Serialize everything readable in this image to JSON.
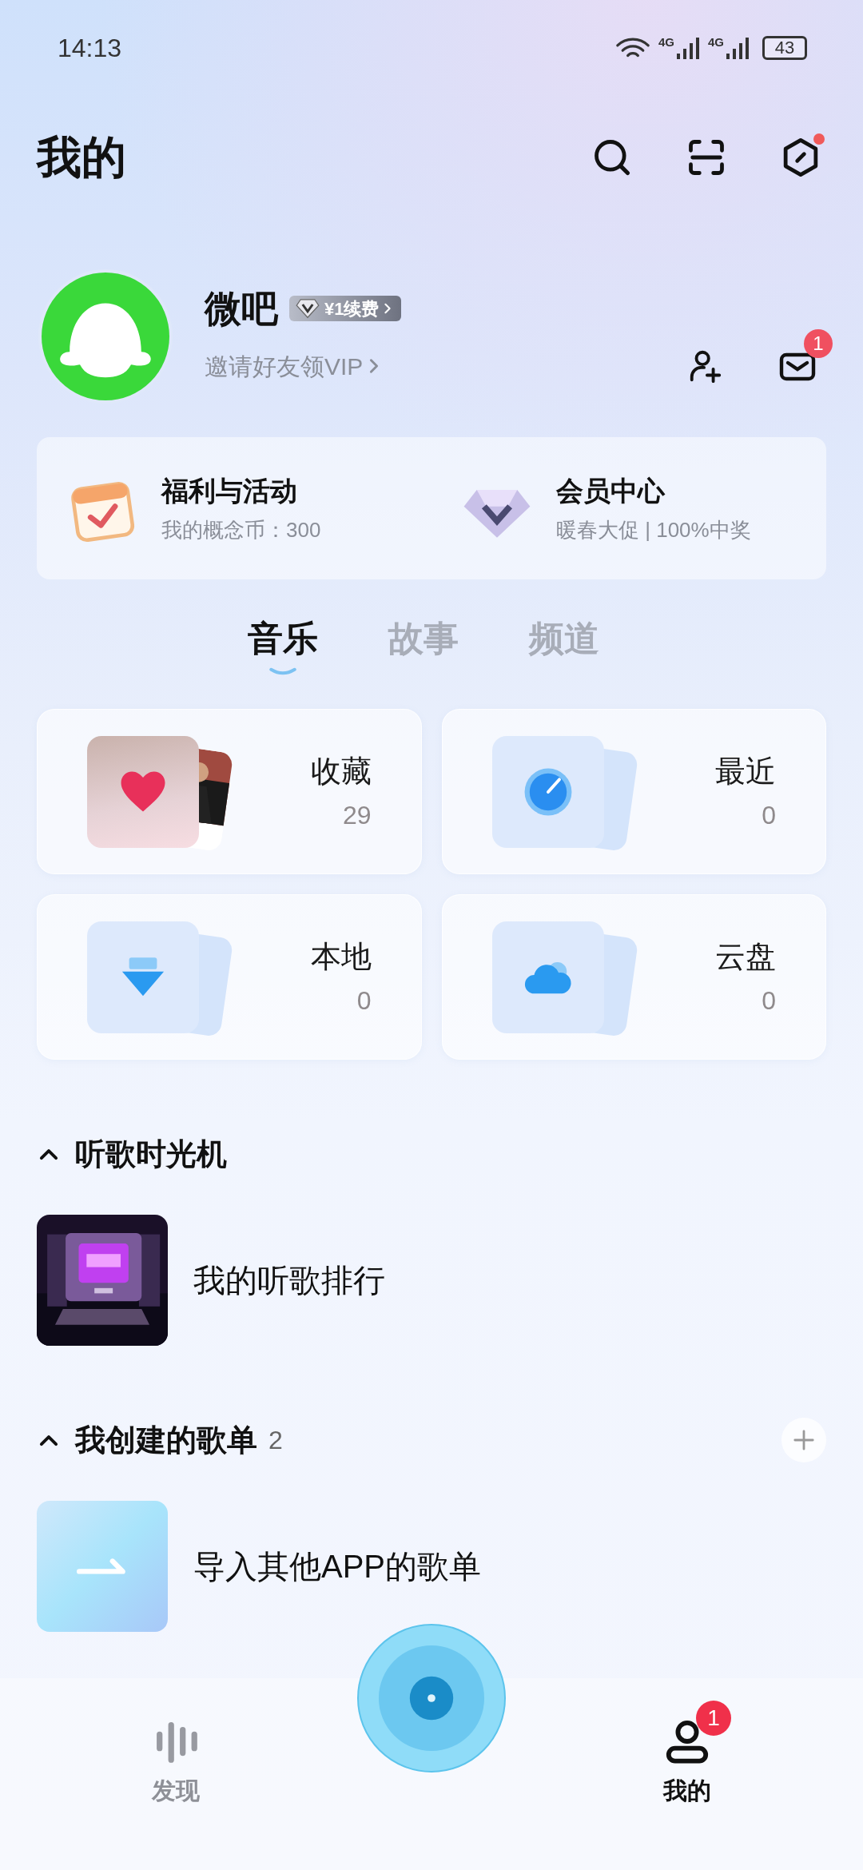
{
  "status_bar": {
    "time": "14:13",
    "networks": [
      "4G",
      "4G"
    ],
    "battery": "43"
  },
  "header": {
    "title": "我的",
    "settings_dot": true
  },
  "profile": {
    "name": "微吧",
    "vip_badge": "¥1续费",
    "invite_link": "邀请好友领VIP",
    "messages_badge": "1"
  },
  "promos": [
    {
      "kind": "calendar",
      "title": "福利与活动",
      "subtitle": "我的概念币：300"
    },
    {
      "kind": "diamond",
      "title": "会员中心",
      "subtitle": "暖春大促 | 100%中奖"
    }
  ],
  "tabs": [
    {
      "label": "音乐",
      "selected": true
    },
    {
      "label": "故事",
      "selected": false
    },
    {
      "label": "频道",
      "selected": false
    }
  ],
  "library": [
    {
      "kind": "favorites",
      "label": "收藏",
      "count": "29"
    },
    {
      "kind": "recent",
      "label": "最近",
      "count": "0"
    },
    {
      "kind": "local",
      "label": "本地",
      "count": "0"
    },
    {
      "kind": "cloud",
      "label": "云盘",
      "count": "0"
    }
  ],
  "sections": [
    {
      "title": "听歌时光机",
      "expanded": true,
      "items": [
        {
          "kind": "picture",
          "title": "我的听歌排行"
        }
      ]
    },
    {
      "title": "我创建的歌单",
      "count": "2",
      "expanded": true,
      "items": [
        {
          "kind": "import",
          "title": "导入其他APP的歌单"
        }
      ]
    }
  ],
  "bottom_nav": [
    {
      "kind": "discover",
      "label": "发现",
      "selected": false
    },
    {
      "kind": "player"
    },
    {
      "kind": "profile",
      "label": "我的",
      "selected": true,
      "badge": "1"
    }
  ]
}
